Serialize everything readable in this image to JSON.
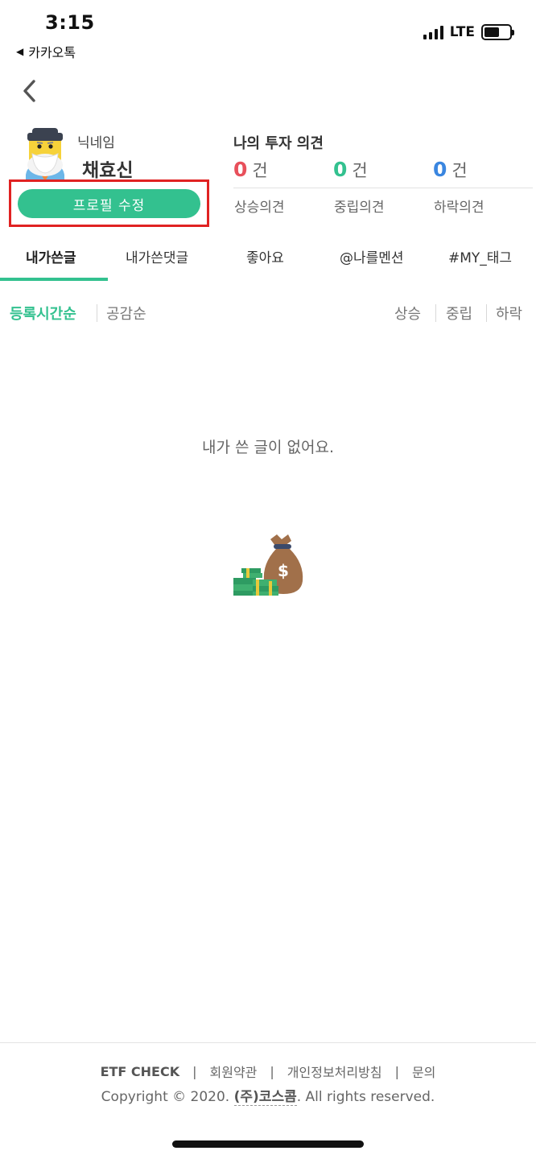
{
  "status_bar": {
    "time": "3:15",
    "back_app": "카카오톡",
    "network": "LTE"
  },
  "profile": {
    "nickname_label": "닉네임",
    "nickname": "채효신",
    "edit_button": "프로필 수정"
  },
  "opinions": {
    "title": "나의 투자 의견",
    "unit": "건",
    "items": [
      {
        "count": "0",
        "label": "상승의견",
        "color": "#e8505b"
      },
      {
        "count": "0",
        "label": "중립의견",
        "color": "#33c18f"
      },
      {
        "count": "0",
        "label": "하락의견",
        "color": "#3a86e0"
      }
    ]
  },
  "tabs": [
    {
      "label": "내가쓴글",
      "active": true
    },
    {
      "label": "내가쓴댓글",
      "active": false
    },
    {
      "label": "좋아요",
      "active": false
    },
    {
      "label": "@나를멘션",
      "active": false
    },
    {
      "label": "#MY_태그",
      "active": false
    }
  ],
  "sort": {
    "left": [
      "등록시간순",
      "공감순"
    ],
    "right": [
      "상승",
      "중립",
      "하락"
    ]
  },
  "empty": {
    "message": "내가 쓴 글이 없어요.",
    "illustration_icon": "money-bag-icon"
  },
  "footer": {
    "brand": "ETF CHECK",
    "separator": "|",
    "links": [
      "회원약관",
      "개인정보처리방침",
      "문의"
    ],
    "copyright_prefix": "Copyright © 2020.",
    "company": "(주)코스콤",
    "copyright_suffix": ". All rights reserved."
  },
  "colors": {
    "accent_green": "#33c18f",
    "highlight_red": "#e02222"
  }
}
